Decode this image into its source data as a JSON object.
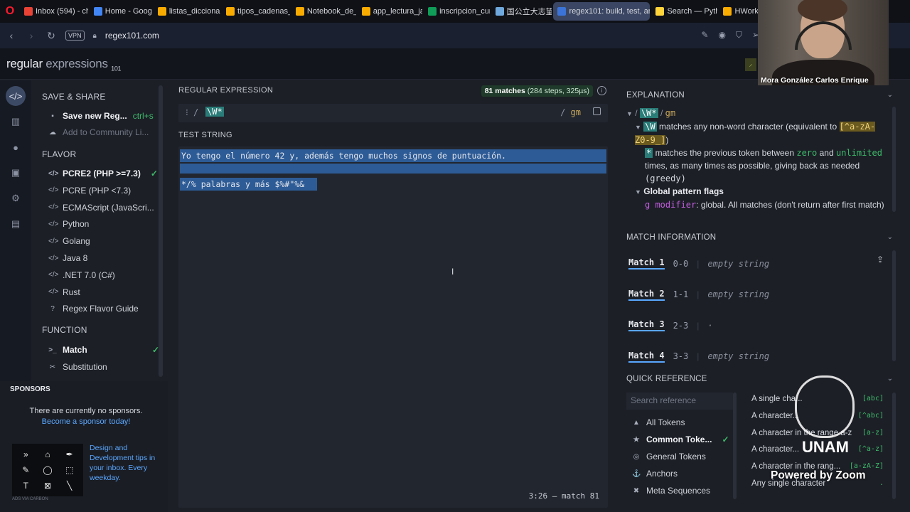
{
  "browser": {
    "tabs": [
      {
        "label": "Inbox (594) - ch",
        "color": "#ea4335"
      },
      {
        "label": "Home - Googl",
        "color": "#4285f4"
      },
      {
        "label": "listas_diccionar",
        "color": "#f9ab00"
      },
      {
        "label": "tipos_cadenas_",
        "color": "#f9ab00"
      },
      {
        "label": "Notebook_de_",
        "color": "#f9ab00"
      },
      {
        "label": "app_lectura_ja",
        "color": "#f9ab00"
      },
      {
        "label": "inscripcion_cur",
        "color": "#0f9d58"
      },
      {
        "label": "国公立大志望",
        "color": "#6fa8dc"
      },
      {
        "label": "regex101: build, test, and",
        "color": "#3b74d6"
      },
      {
        "label": "Search — Pyth",
        "color": "#ffd43b"
      },
      {
        "label": "HWork",
        "color": "#f9ab00"
      }
    ],
    "vpn": "VPN",
    "url": "regex101.com"
  },
  "site": {
    "logo_main": "regular",
    "logo_light": " expressions",
    "logo_sub": "101"
  },
  "left": {
    "save_share": "SAVE & SHARE",
    "save_new": "Save new Reg...",
    "save_shortcut": "ctrl+s",
    "add_community": "Add to Community Li...",
    "flavor": "FLAVOR",
    "flavors": [
      "PCRE2 (PHP >=7.3)",
      "PCRE (PHP <7.3)",
      "ECMAScript (JavaScri...",
      "Python",
      "Golang",
      "Java 8",
      ".NET 7.0 (C#)",
      "Rust"
    ],
    "flavor_guide": "Regex Flavor Guide",
    "function": "FUNCTION",
    "functions": [
      "Match",
      "Substitution"
    ]
  },
  "sponsors": {
    "title": "SPONSORS",
    "text": "There are currently no sponsors.",
    "link": "Become a sponsor today!",
    "ad_text": "Design and Development tips in your inbox. Every weekday.",
    "ad_foot": "ADS VIA CARBON"
  },
  "regex": {
    "header": "REGULAR EXPRESSION",
    "badge_count": "81 matches",
    "badge_detail": " (284 steps, 325µs)",
    "delim_open": "/",
    "pattern": "\\W*",
    "delim_close": "/",
    "flags": "gm"
  },
  "test": {
    "header": "TEST STRING",
    "line1": "Yo tengo el número 42 y, además tengo muchos signos de puntuación.",
    "line3": "*/% palabras y más $%#\"%&",
    "status": "3:26 — match 81"
  },
  "explanation": {
    "header": "EXPLANATION",
    "root_pattern": "\\W*",
    "root_flags": "gm",
    "token": "\\W",
    "desc1": " matches any non-word character (equivalent to ",
    "class": "[^a-zA-Z0-9_]",
    "desc1_end": ")",
    "quant": "*",
    "desc2a": " matches the previous token between ",
    "zero": "zero",
    "and": " and ",
    "unlimited": "unlimited",
    "desc2b": " times, as many times as possible, giving back as needed ",
    "greedy": "(greedy)",
    "flags_title": "Global pattern flags",
    "g_label": "g modifier",
    "g_desc": ": global. All matches (don't return after first match)"
  },
  "match_info": {
    "header": "MATCH INFORMATION",
    "rows": [
      {
        "name": "Match 1",
        "range": "0-0",
        "value": "empty string"
      },
      {
        "name": "Match 2",
        "range": "1-1",
        "value": "empty string"
      },
      {
        "name": "Match 3",
        "range": "2-3",
        "value": "·"
      },
      {
        "name": "Match 4",
        "range": "3-3",
        "value": "empty string"
      }
    ]
  },
  "quick_ref": {
    "header": "QUICK REFERENCE",
    "search_placeholder": "Search reference",
    "categories": [
      "All Tokens",
      "Common Toke...",
      "General Tokens",
      "Anchors",
      "Meta Sequences"
    ],
    "items": [
      {
        "label": "A single cha...",
        "code": "[abc]"
      },
      {
        "label": "A character...",
        "code": "[^abc]"
      },
      {
        "label": "A character in the range a-z",
        "code": "[a-z]"
      },
      {
        "label": "A character...",
        "code": "[^a-z]"
      },
      {
        "label": "A character in the rang...",
        "code": "[a-zA-Z]"
      },
      {
        "label": "Any single character",
        "code": "."
      }
    ]
  },
  "overlay": {
    "participant": "Mora González Carlos Enrique",
    "unam": "UNAM",
    "powered": "Powered by Zoom"
  },
  "colors": {
    "accent": "#5aa7ff",
    "match_green": "#3dbb6a",
    "token_teal": "#2a7c78",
    "highlight": "#2d5b96"
  }
}
